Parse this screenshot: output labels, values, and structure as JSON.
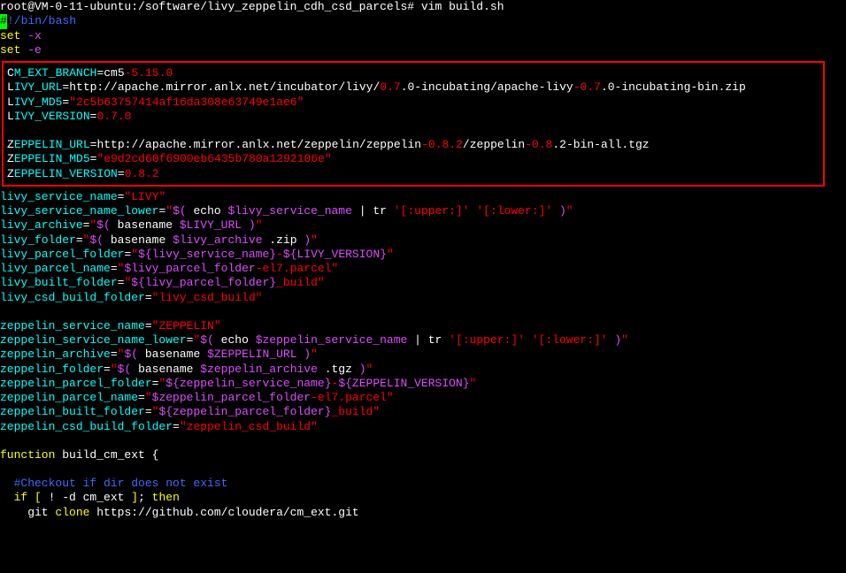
{
  "prompt_line": "root@VM-0-11-ubuntu:/software/livy_zeppelin_cdh_csd_parcels# vim build.sh",
  "shebang_hash": "#",
  "shebang_rest": "!/bin/bash",
  "set_x_a": "set",
  "set_x_b": " -x",
  "set_e_a": "set",
  "set_e_b": " -e",
  "box": {
    "l1_a": "C",
    "l1_b": "M_EXT_BRANCH",
    "l1_c": "=cm5",
    "l1_d": "-5.15.0",
    "l2_a": "L",
    "l2_b": "IVY_URL",
    "l2_c": "=http://apache.mirror.anlx.net/incubator/livy/",
    "l2_d": "0.7",
    "l2_e": ".0-incubating/apache-livy",
    "l2_f": "-0.7",
    "l2_g": ".0-incubating-bin.zip",
    "l3_a": "L",
    "l3_b": "IVY_MD5",
    "l3_c": "=",
    "l3_d": "\"2c5b63757414af16da308e63749e1ae6\"",
    "l4_a": "L",
    "l4_b": "IVY_VERSION",
    "l4_c": "=",
    "l4_d": "0.7.0",
    "l5_a": "Z",
    "l5_b": "EPPELIN_URL",
    "l5_c": "=http://apache.mirror.anlx.net/zeppelin/zeppelin",
    "l5_d": "-0.8.2",
    "l5_e": "/zeppelin",
    "l5_f": "-0.8",
    "l5_g": ".2-bin-all.tgz",
    "l6_a": "Z",
    "l6_b": "EPPELIN_MD5",
    "l6_c": "=",
    "l6_d": "\"e9d2cd60f6900eb6435b780a1292106e\"",
    "l7_a": "Z",
    "l7_b": "EPPELIN_VERSION",
    "l7_c": "=",
    "l7_d": "0.8.2"
  },
  "lsn_a": "livy_service_name",
  "lsn_b": "=",
  "lsn_c": "\"LIVY\"",
  "lsnl_a": "livy_service_name_lower",
  "lsnl_b": "=",
  "lsnl_c": "\"",
  "lsnl_d": "$(",
  "lsnl_e": " echo ",
  "lsnl_f": "$livy_service_name",
  "lsnl_g": " | tr ",
  "lsnl_h": "'[:upper:]' '[:lower:]'",
  "lsnl_i": " )",
  "lsnl_j": "\"",
  "la_a": "livy_archive",
  "la_b": "=",
  "la_c": "\"",
  "la_d": "$(",
  "la_e": " basename ",
  "la_f": "$LIVY_URL",
  "la_g": " )",
  "la_h": "\"",
  "lf_a": "livy_folder",
  "lf_b": "=",
  "lf_c": "\"",
  "lf_d": "$(",
  "lf_e": " basename ",
  "lf_f": "$livy_archive",
  "lf_g": " .zip ",
  "lf_h": ")",
  "lf_i": "\"",
  "lpf_a": "livy_parcel_folder",
  "lpf_b": "=",
  "lpf_c": "\"",
  "lpf_d": "${livy_service_name}",
  "lpf_e": "-",
  "lpf_f": "${LIVY_VERSION}",
  "lpf_g": "\"",
  "lpn_a": "livy_parcel_name",
  "lpn_b": "=",
  "lpn_c": "\"",
  "lpn_d": "$livy_parcel_folder",
  "lpn_e": "-el7.parcel",
  "lpn_f": "\"",
  "lbf_a": "livy_built_folder",
  "lbf_b": "=",
  "lbf_c": "\"",
  "lbf_d": "${livy_parcel_folder}",
  "lbf_e": "_build",
  "lbf_f": "\"",
  "lcbf_a": "livy_csd_build_folder",
  "lcbf_b": "=",
  "lcbf_c": "\"livy_csd_build\"",
  "zsn_a": "zeppelin_service_name",
  "zsn_b": "=",
  "zsn_c": "\"ZEPPELIN\"",
  "zsnl_a": "zeppelin_service_name_lower",
  "zsnl_b": "=",
  "zsnl_c": "\"",
  "zsnl_d": "$(",
  "zsnl_e": " echo ",
  "zsnl_f": "$zeppelin_service_name",
  "zsnl_g": " | tr ",
  "zsnl_h": "'[:upper:]' '[:lower:]'",
  "zsnl_i": " )",
  "zsnl_j": "\"",
  "za_a": "zeppelin_archive",
  "za_b": "=",
  "za_c": "\"",
  "za_d": "$(",
  "za_e": " basename ",
  "za_f": "$ZEPPELIN_URL",
  "za_g": " )",
  "za_h": "\"",
  "zf_a": "zeppelin_folder",
  "zf_b": "=",
  "zf_c": "\"",
  "zf_d": "$(",
  "zf_e": " basename ",
  "zf_f": "$zeppelin_archive",
  "zf_g": " .tgz ",
  "zf_h": ")",
  "zf_i": "\"",
  "zpf_a": "zeppelin_parcel_folder",
  "zpf_b": "=",
  "zpf_c": "\"",
  "zpf_d": "${zeppelin_service_name}",
  "zpf_e": "-",
  "zpf_f": "${ZEPPELIN_VERSION}",
  "zpf_g": "\"",
  "zpn_a": "zeppelin_parcel_name",
  "zpn_b": "=",
  "zpn_c": "\"",
  "zpn_d": "$zeppelin_parcel_folder",
  "zpn_e": "-el7.parcel",
  "zpn_f": "\"",
  "zbf_a": "zeppelin_built_folder",
  "zbf_b": "=",
  "zbf_c": "\"",
  "zbf_d": "${zeppelin_parcel_folder}",
  "zbf_e": "_build",
  "zbf_f": "\"",
  "zcbf_a": "zeppelin_csd_build_folder",
  "zcbf_b": "=",
  "zcbf_c": "\"zeppelin_csd_build\"",
  "func_a": "function",
  "func_b": " build_cm_ext ",
  "func_c": "{",
  "comment": "  #Checkout if dir does not exist",
  "if_a": "  if",
  "if_b": " [",
  "if_c": " ! -d cm_ext ",
  "if_d": "]",
  "if_e": ";",
  "if_f": " then",
  "git_a": "    git ",
  "git_b": "clone",
  "git_c": " https://github.com/cloudera/cm_ext.git"
}
